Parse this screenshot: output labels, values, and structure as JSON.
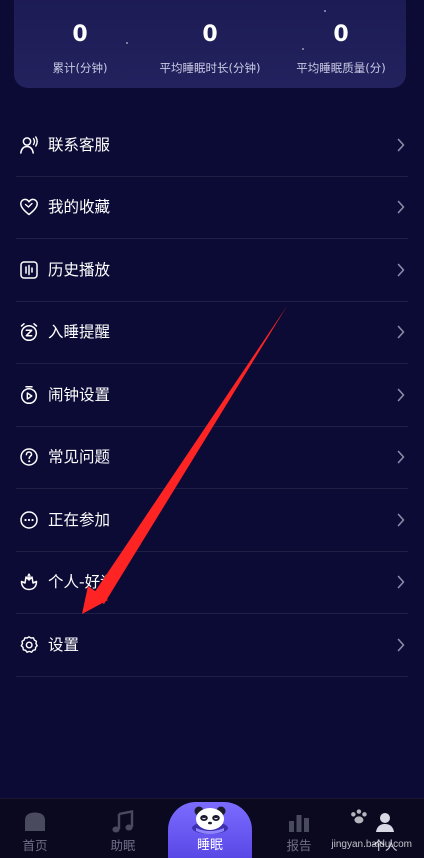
{
  "stats": [
    {
      "value": "0",
      "label": "累计(分钟)"
    },
    {
      "value": "0",
      "label": "平均睡眠时长(分钟)"
    },
    {
      "value": "0",
      "label": "平均睡眠质量(分)"
    }
  ],
  "menu": {
    "items": [
      {
        "label": "联系客服",
        "icon": "customer-service-icon"
      },
      {
        "label": "我的收藏",
        "icon": "heart-icon"
      },
      {
        "label": "历史播放",
        "icon": "history-icon"
      },
      {
        "label": "入睡提醒",
        "icon": "sleep-alarm-icon"
      },
      {
        "label": "闹钟设置",
        "icon": "alarm-clock-icon"
      },
      {
        "label": "常见问题",
        "icon": "help-icon"
      },
      {
        "label": "正在参加",
        "icon": "more-icon"
      },
      {
        "label": "个人-好评",
        "icon": "flower-icon"
      },
      {
        "label": "设置",
        "icon": "gear-icon"
      }
    ]
  },
  "tabs": [
    {
      "label": "首页",
      "icon": "home-icon"
    },
    {
      "label": "助眠",
      "icon": "music-note-icon"
    },
    {
      "label": "睡眠",
      "icon": "panda-icon"
    },
    {
      "label": "报告",
      "icon": "bar-chart-icon"
    },
    {
      "label": "个人",
      "icon": "person-icon"
    }
  ],
  "watermark": {
    "text": "jingyan.baidu.com"
  },
  "colors": {
    "background": "#0c0b36",
    "card": "#1f1e5a",
    "accent": "#6c5cf5",
    "annotation": "#ff2a2a"
  }
}
